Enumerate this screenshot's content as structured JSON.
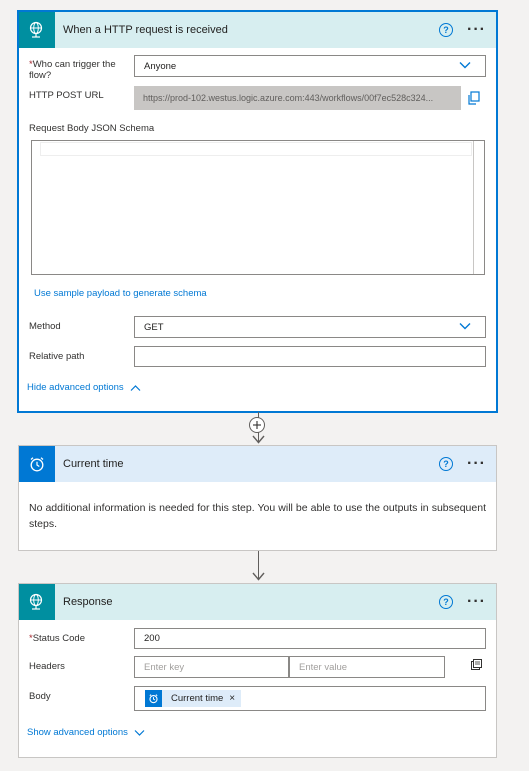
{
  "trigger": {
    "title": "When a HTTP request is received",
    "header_color": "#d7eef0",
    "who_label": "Who can trigger the flow?",
    "who_value": "Anyone",
    "url_label": "HTTP POST URL",
    "url_value": "https://prod-102.westus.logic.azure.com:443/workflows/00f7ec528c324...",
    "schema_label": "Request Body JSON Schema",
    "sample_payload_link": "Use sample payload to generate schema",
    "method_label": "Method",
    "method_value": "GET",
    "relative_path_label": "Relative path",
    "relative_path_value": "",
    "hide_advanced": "Hide advanced options"
  },
  "current_time": {
    "title": "Current time",
    "header_color": "#deecf9",
    "info": "No additional information is needed for this step. You will be able to use the outputs in subsequent steps."
  },
  "response": {
    "title": "Response",
    "header_color": "#d7eef0",
    "status_label": "Status Code",
    "status_value": "200",
    "headers_label": "Headers",
    "key_placeholder": "Enter key",
    "value_placeholder": "Enter value",
    "body_label": "Body",
    "body_token": "Current time",
    "show_advanced": "Show advanced options"
  },
  "icons": {
    "help": "?",
    "more": "···",
    "token_remove": "×"
  }
}
